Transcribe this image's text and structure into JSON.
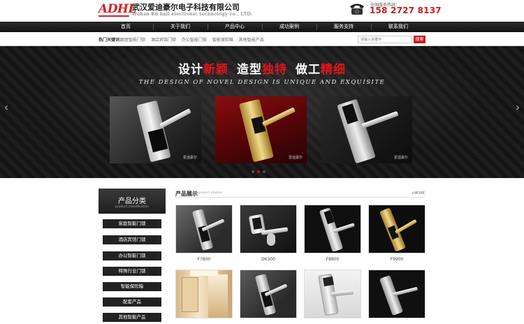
{
  "header": {
    "logo_text": "ADHL",
    "company_cn": "武汉爱迪豪尔电子科技有限公司",
    "company_en": "Wuhan Ed hall electronic technology co., LTD.",
    "hotline_label": "全国服务热线：",
    "hotline_number": "158 2727 8137"
  },
  "nav": {
    "items": [
      "首页",
      "关于我们",
      "产品中心",
      "成功案例",
      "服务支持",
      "联系我们"
    ]
  },
  "hotbar": {
    "label": "热门关键词：",
    "links": [
      "家庭智能门锁",
      "酒店宾馆门锁",
      "办公智能门锁",
      "智能保险箱",
      "其他智能产品"
    ],
    "search_placeholder": "请输入关键字",
    "search_button": "搜索"
  },
  "banner": {
    "slogan_parts": [
      {
        "text": "设计",
        "red": false
      },
      {
        "text": "新颖",
        "red": true
      },
      {
        "text": "造型",
        "red": false
      },
      {
        "text": "独特",
        "red": true
      },
      {
        "text": "做工",
        "red": false
      },
      {
        "text": "精细",
        "red": true
      }
    ],
    "slogan_en": "THE DESIGN OF NOVEL DESIGN IS UNIQUE AND EXQUISITE",
    "panel_captions": [
      "爱迪豪尔",
      "爱迪豪尔",
      "爱迪豪尔"
    ],
    "prev_arrow": "‹",
    "next_arrow": "›",
    "slide_count": 3,
    "active_slide": 2
  },
  "sidebar": {
    "title": "产品分类",
    "subtitle": "product classification",
    "categories": [
      "家庭智能门锁",
      "酒店宾馆门锁",
      "办公智能门锁",
      "特殊行业门锁",
      "智能保险箱",
      "配套产品",
      "其他智能产品"
    ]
  },
  "products": {
    "title": "产品展示",
    "subtitle": "product display",
    "more": "+MORE",
    "items": [
      {
        "name": "F7800"
      },
      {
        "name": "D6300"
      },
      {
        "name": "F8800"
      },
      {
        "name": "F9900"
      },
      {
        "name": ""
      },
      {
        "name": ""
      },
      {
        "name": ""
      },
      {
        "name": ""
      }
    ]
  },
  "colors": {
    "brand_red": "#d51f26",
    "nav_bg": "#1a1a1a",
    "category_bg": "#222222"
  }
}
